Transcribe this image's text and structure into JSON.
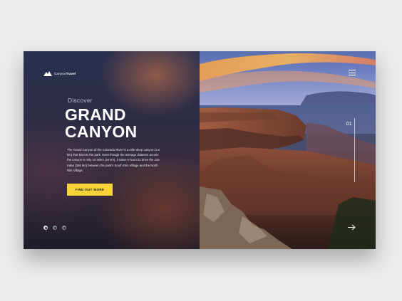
{
  "brand": {
    "name_regular": "Canyon",
    "name_bold": "Travel"
  },
  "hero": {
    "eyebrow": "Discover",
    "title_line1": "GRAND",
    "title_line2": "CANYON",
    "description": "The Grand Canyon of the Colorado River is a mile-deep canyon (1.6 km) that bisects the park. Even though the average distance across the canyon is only 10 miles (16 km), it takes 5 hours to drive the 215 miles (346 km) between the park's South Rim Village and the North Rim Village.",
    "cta_label": "FIND OUT MORE"
  },
  "slider": {
    "current": "01"
  },
  "colors": {
    "accent": "#f7d238",
    "panel_dark": "#2a3050",
    "text_muted": "#b8bfd6"
  },
  "icons": {
    "logo": "mountain-logo-icon",
    "menu": "hamburger-menu-icon",
    "next": "arrow-right-icon",
    "social": [
      "instagram-icon",
      "twitter-icon",
      "pinterest-icon"
    ]
  }
}
